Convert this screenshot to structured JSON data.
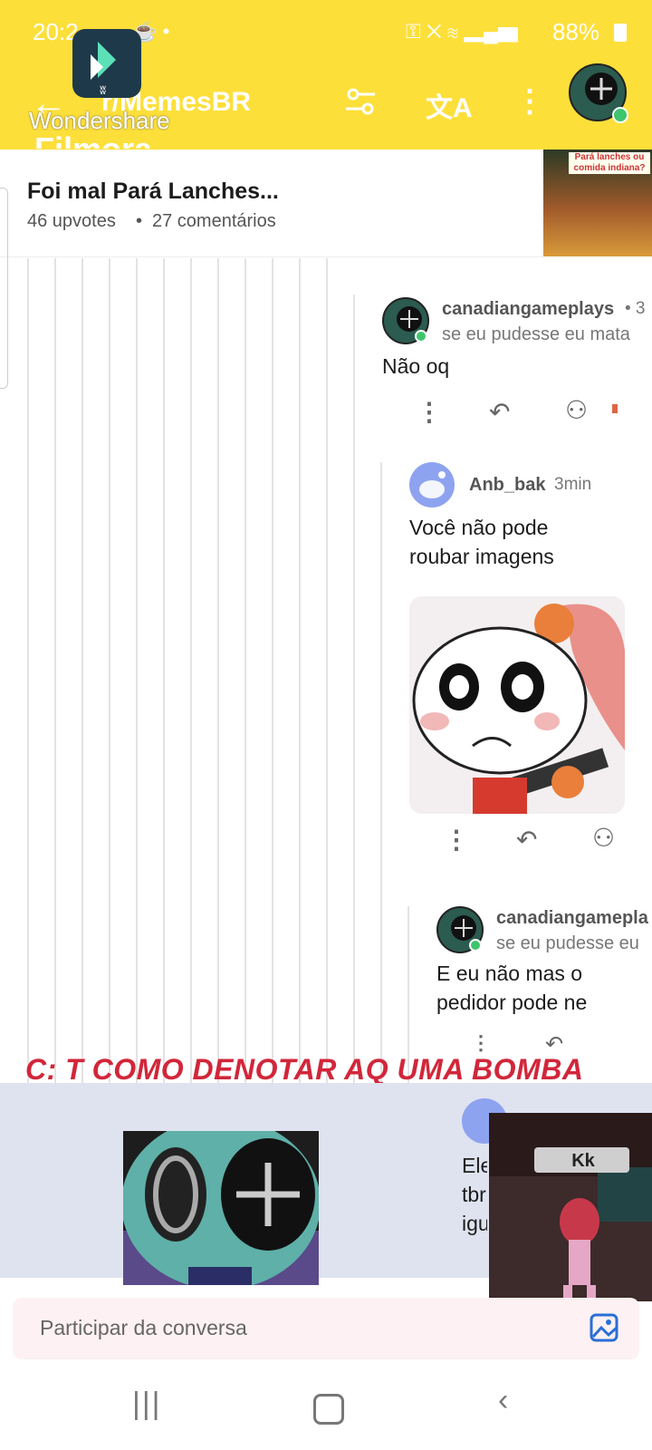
{
  "status_bar": {
    "time": "20:2",
    "battery": "88%"
  },
  "watermark": {
    "brand": "Wondershare",
    "product": "Filmora"
  },
  "header": {
    "subreddit": "r/MemesBR"
  },
  "post": {
    "title": "Foi mal Pará Lanches...",
    "upvotes": "46 upvotes",
    "comments": "27 comentários",
    "thumb_caption": "Pará lanches ou comida indiana?"
  },
  "comments": [
    {
      "user": "canadiangameplays",
      "time": "• 3",
      "subtitle": "se eu pudesse eu mata",
      "text": "Não oq"
    },
    {
      "user": "Anb_bak",
      "time": "3min",
      "text": "Você não pode roubar imagens"
    },
    {
      "user": "canadiangamepla",
      "subtitle": "se eu pudesse eu",
      "text": "E eu não mas o pedidor pode ne"
    },
    {
      "text_partial": "Ele tbr igu"
    }
  ],
  "overlay_caption": "C: T COMO DENOTAR AQ UMA BOMBA TERMONUCLEAR?",
  "game_overlay": {
    "label": "Kk"
  },
  "input": {
    "placeholder": "Participar da conversa"
  },
  "colors": {
    "header_bg": "#fddf3a",
    "caption": "#d2263a",
    "online": "#3ec46d"
  }
}
